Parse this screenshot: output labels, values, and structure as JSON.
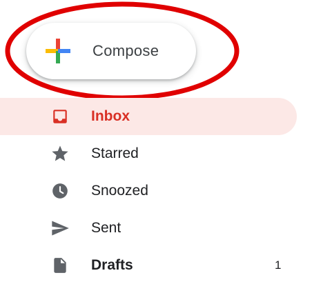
{
  "compose": {
    "label": "Compose"
  },
  "nav": {
    "items": [
      {
        "label": "Inbox",
        "icon": "inbox-icon",
        "active": true
      },
      {
        "label": "Starred",
        "icon": "star-icon"
      },
      {
        "label": "Snoozed",
        "icon": "clock-icon"
      },
      {
        "label": "Sent",
        "icon": "send-icon"
      },
      {
        "label": "Drafts",
        "icon": "draft-icon",
        "count": "1",
        "bold": true
      }
    ]
  },
  "colors": {
    "active_bg": "#fce8e6",
    "active_text": "#d93025",
    "icon_gray": "#5f6368",
    "highlight_red": "#e00000",
    "plus_blue": "#4285f4",
    "plus_red": "#ea4335",
    "plus_yellow": "#fbbc04",
    "plus_green": "#34a853"
  }
}
